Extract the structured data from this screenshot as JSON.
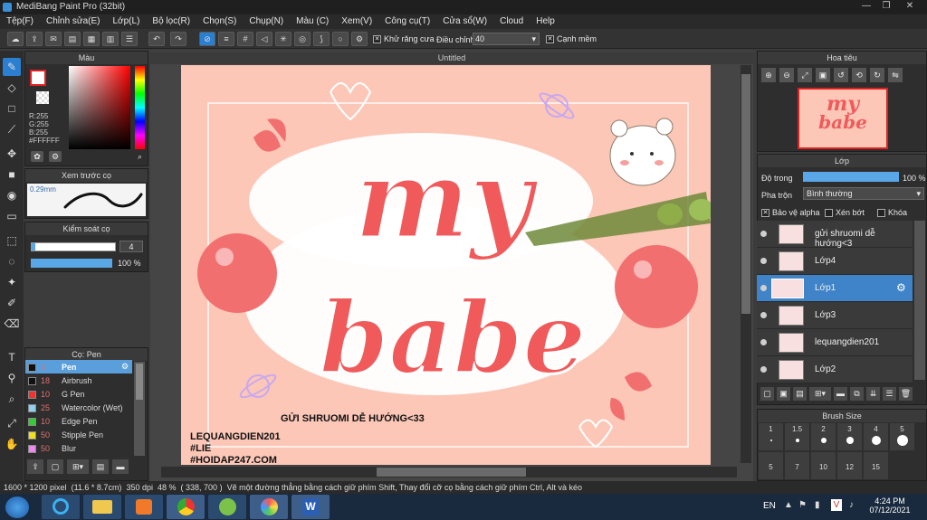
{
  "window": {
    "title": "MediBang Paint Pro (32bit)",
    "min": "—",
    "max": "❐",
    "close": "✕"
  },
  "menu": [
    "Tệp(F)",
    "Chỉnh sửa(E)",
    "Lớp(L)",
    "Bộ lọc(R)",
    "Chọn(S)",
    "Chụp(N)",
    "Màu (C)",
    "Xem(V)",
    "Công cụ(T)",
    "Cửa sổ(W)",
    "Cloud",
    "Help"
  ],
  "toolbar": {
    "antialias": "Khử răng cưa",
    "adjust_label": "Điều chỉnh",
    "adjust_value": "40",
    "smooth": "Cạnh mềm"
  },
  "color_panel": {
    "title": "Màu",
    "r": "R:255",
    "g": "G:255",
    "b": "B:255",
    "hex": "#FFFFFF"
  },
  "brush_preview": {
    "title": "Xem trước cọ",
    "size": "0.29mm"
  },
  "brush_control": {
    "title": "Kiểm soát cọ",
    "size": "4",
    "opacity": "100 %"
  },
  "brush_list": {
    "title": "Cọ: Pen",
    "items": [
      {
        "size": "4",
        "name": "Pen",
        "color": "#111111"
      },
      {
        "size": "18",
        "name": "Airbrush",
        "color": "#111111"
      },
      {
        "size": "10",
        "name": "G Pen",
        "color": "#ee3333"
      },
      {
        "size": "25",
        "name": "Watercolor (Wet)",
        "color": "#8fd0f0"
      },
      {
        "size": "10",
        "name": "Edge Pen",
        "color": "#33cc33"
      },
      {
        "size": "50",
        "name": "Stipple Pen",
        "color": "#eedd22"
      },
      {
        "size": "50",
        "name": "Blur",
        "color": "#ee88ee"
      }
    ]
  },
  "canvas": {
    "tab": "Untitled",
    "line1": "my",
    "line2": "babe",
    "caption": "GỬI SHRUOMI DỄ HƯỚNG<33",
    "credit": [
      "LEQUANGDIEN201",
      "#LIE",
      "#HOIDAP247.COM"
    ]
  },
  "navigator": {
    "title": "Hoa tiêu",
    "thumb_line1": "my",
    "thumb_line2": "babe"
  },
  "layers": {
    "title": "Lớp",
    "opacity_label": "Độ trong",
    "opacity_value": "100 %",
    "blend_label": "Pha trộn",
    "blend_value": "Bình thường",
    "protect_alpha": "Bảo vệ alpha",
    "clip": "Xén bớt",
    "lock": "Khóa",
    "items": [
      {
        "name": "gửi shruomi dễ hướng<3",
        "selected": false
      },
      {
        "name": "Lớp4",
        "selected": false
      },
      {
        "name": "Lớp1",
        "selected": true
      },
      {
        "name": "Lớp3",
        "selected": false
      },
      {
        "name": "lequangdien201",
        "selected": false
      },
      {
        "name": "Lớp2",
        "selected": false
      }
    ]
  },
  "brush_size": {
    "title": "Brush Size",
    "row1": [
      "1",
      "1.5",
      "2",
      "3",
      "4",
      "5"
    ],
    "row2": [
      "5",
      "7",
      "10",
      "12",
      "15"
    ]
  },
  "status": {
    "dims": "1600 * 1200 pixel",
    "cm": "(11.6 * 8.7cm)",
    "dpi": "350 dpi",
    "zoom": "48 %",
    "coords": "( 338, 700 )",
    "hint": "Vẽ một đường thẳng bằng cách giữ phím Shift, Thay đổi cỡ cọ bằng cách giữ phím Ctrl, Alt và kéo"
  },
  "taskbar": {
    "lang": "EN",
    "time": "4:24 PM",
    "date": "07/12/2021"
  }
}
